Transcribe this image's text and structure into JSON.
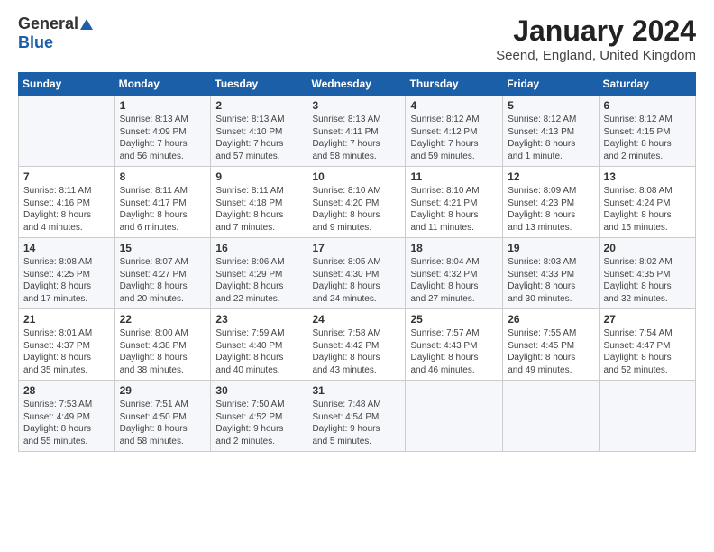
{
  "header": {
    "logo_general": "General",
    "logo_blue": "Blue",
    "title": "January 2024",
    "subtitle": "Seend, England, United Kingdom"
  },
  "columns": [
    "Sunday",
    "Monday",
    "Tuesday",
    "Wednesday",
    "Thursday",
    "Friday",
    "Saturday"
  ],
  "weeks": [
    [
      {
        "day": "",
        "text": ""
      },
      {
        "day": "1",
        "text": "Sunrise: 8:13 AM\nSunset: 4:09 PM\nDaylight: 7 hours\nand 56 minutes."
      },
      {
        "day": "2",
        "text": "Sunrise: 8:13 AM\nSunset: 4:10 PM\nDaylight: 7 hours\nand 57 minutes."
      },
      {
        "day": "3",
        "text": "Sunrise: 8:13 AM\nSunset: 4:11 PM\nDaylight: 7 hours\nand 58 minutes."
      },
      {
        "day": "4",
        "text": "Sunrise: 8:12 AM\nSunset: 4:12 PM\nDaylight: 7 hours\nand 59 minutes."
      },
      {
        "day": "5",
        "text": "Sunrise: 8:12 AM\nSunset: 4:13 PM\nDaylight: 8 hours\nand 1 minute."
      },
      {
        "day": "6",
        "text": "Sunrise: 8:12 AM\nSunset: 4:15 PM\nDaylight: 8 hours\nand 2 minutes."
      }
    ],
    [
      {
        "day": "7",
        "text": "Sunrise: 8:11 AM\nSunset: 4:16 PM\nDaylight: 8 hours\nand 4 minutes."
      },
      {
        "day": "8",
        "text": "Sunrise: 8:11 AM\nSunset: 4:17 PM\nDaylight: 8 hours\nand 6 minutes."
      },
      {
        "day": "9",
        "text": "Sunrise: 8:11 AM\nSunset: 4:18 PM\nDaylight: 8 hours\nand 7 minutes."
      },
      {
        "day": "10",
        "text": "Sunrise: 8:10 AM\nSunset: 4:20 PM\nDaylight: 8 hours\nand 9 minutes."
      },
      {
        "day": "11",
        "text": "Sunrise: 8:10 AM\nSunset: 4:21 PM\nDaylight: 8 hours\nand 11 minutes."
      },
      {
        "day": "12",
        "text": "Sunrise: 8:09 AM\nSunset: 4:23 PM\nDaylight: 8 hours\nand 13 minutes."
      },
      {
        "day": "13",
        "text": "Sunrise: 8:08 AM\nSunset: 4:24 PM\nDaylight: 8 hours\nand 15 minutes."
      }
    ],
    [
      {
        "day": "14",
        "text": "Sunrise: 8:08 AM\nSunset: 4:25 PM\nDaylight: 8 hours\nand 17 minutes."
      },
      {
        "day": "15",
        "text": "Sunrise: 8:07 AM\nSunset: 4:27 PM\nDaylight: 8 hours\nand 20 minutes."
      },
      {
        "day": "16",
        "text": "Sunrise: 8:06 AM\nSunset: 4:29 PM\nDaylight: 8 hours\nand 22 minutes."
      },
      {
        "day": "17",
        "text": "Sunrise: 8:05 AM\nSunset: 4:30 PM\nDaylight: 8 hours\nand 24 minutes."
      },
      {
        "day": "18",
        "text": "Sunrise: 8:04 AM\nSunset: 4:32 PM\nDaylight: 8 hours\nand 27 minutes."
      },
      {
        "day": "19",
        "text": "Sunrise: 8:03 AM\nSunset: 4:33 PM\nDaylight: 8 hours\nand 30 minutes."
      },
      {
        "day": "20",
        "text": "Sunrise: 8:02 AM\nSunset: 4:35 PM\nDaylight: 8 hours\nand 32 minutes."
      }
    ],
    [
      {
        "day": "21",
        "text": "Sunrise: 8:01 AM\nSunset: 4:37 PM\nDaylight: 8 hours\nand 35 minutes."
      },
      {
        "day": "22",
        "text": "Sunrise: 8:00 AM\nSunset: 4:38 PM\nDaylight: 8 hours\nand 38 minutes."
      },
      {
        "day": "23",
        "text": "Sunrise: 7:59 AM\nSunset: 4:40 PM\nDaylight: 8 hours\nand 40 minutes."
      },
      {
        "day": "24",
        "text": "Sunrise: 7:58 AM\nSunset: 4:42 PM\nDaylight: 8 hours\nand 43 minutes."
      },
      {
        "day": "25",
        "text": "Sunrise: 7:57 AM\nSunset: 4:43 PM\nDaylight: 8 hours\nand 46 minutes."
      },
      {
        "day": "26",
        "text": "Sunrise: 7:55 AM\nSunset: 4:45 PM\nDaylight: 8 hours\nand 49 minutes."
      },
      {
        "day": "27",
        "text": "Sunrise: 7:54 AM\nSunset: 4:47 PM\nDaylight: 8 hours\nand 52 minutes."
      }
    ],
    [
      {
        "day": "28",
        "text": "Sunrise: 7:53 AM\nSunset: 4:49 PM\nDaylight: 8 hours\nand 55 minutes."
      },
      {
        "day": "29",
        "text": "Sunrise: 7:51 AM\nSunset: 4:50 PM\nDaylight: 8 hours\nand 58 minutes."
      },
      {
        "day": "30",
        "text": "Sunrise: 7:50 AM\nSunset: 4:52 PM\nDaylight: 9 hours\nand 2 minutes."
      },
      {
        "day": "31",
        "text": "Sunrise: 7:48 AM\nSunset: 4:54 PM\nDaylight: 9 hours\nand 5 minutes."
      },
      {
        "day": "",
        "text": ""
      },
      {
        "day": "",
        "text": ""
      },
      {
        "day": "",
        "text": ""
      }
    ]
  ]
}
